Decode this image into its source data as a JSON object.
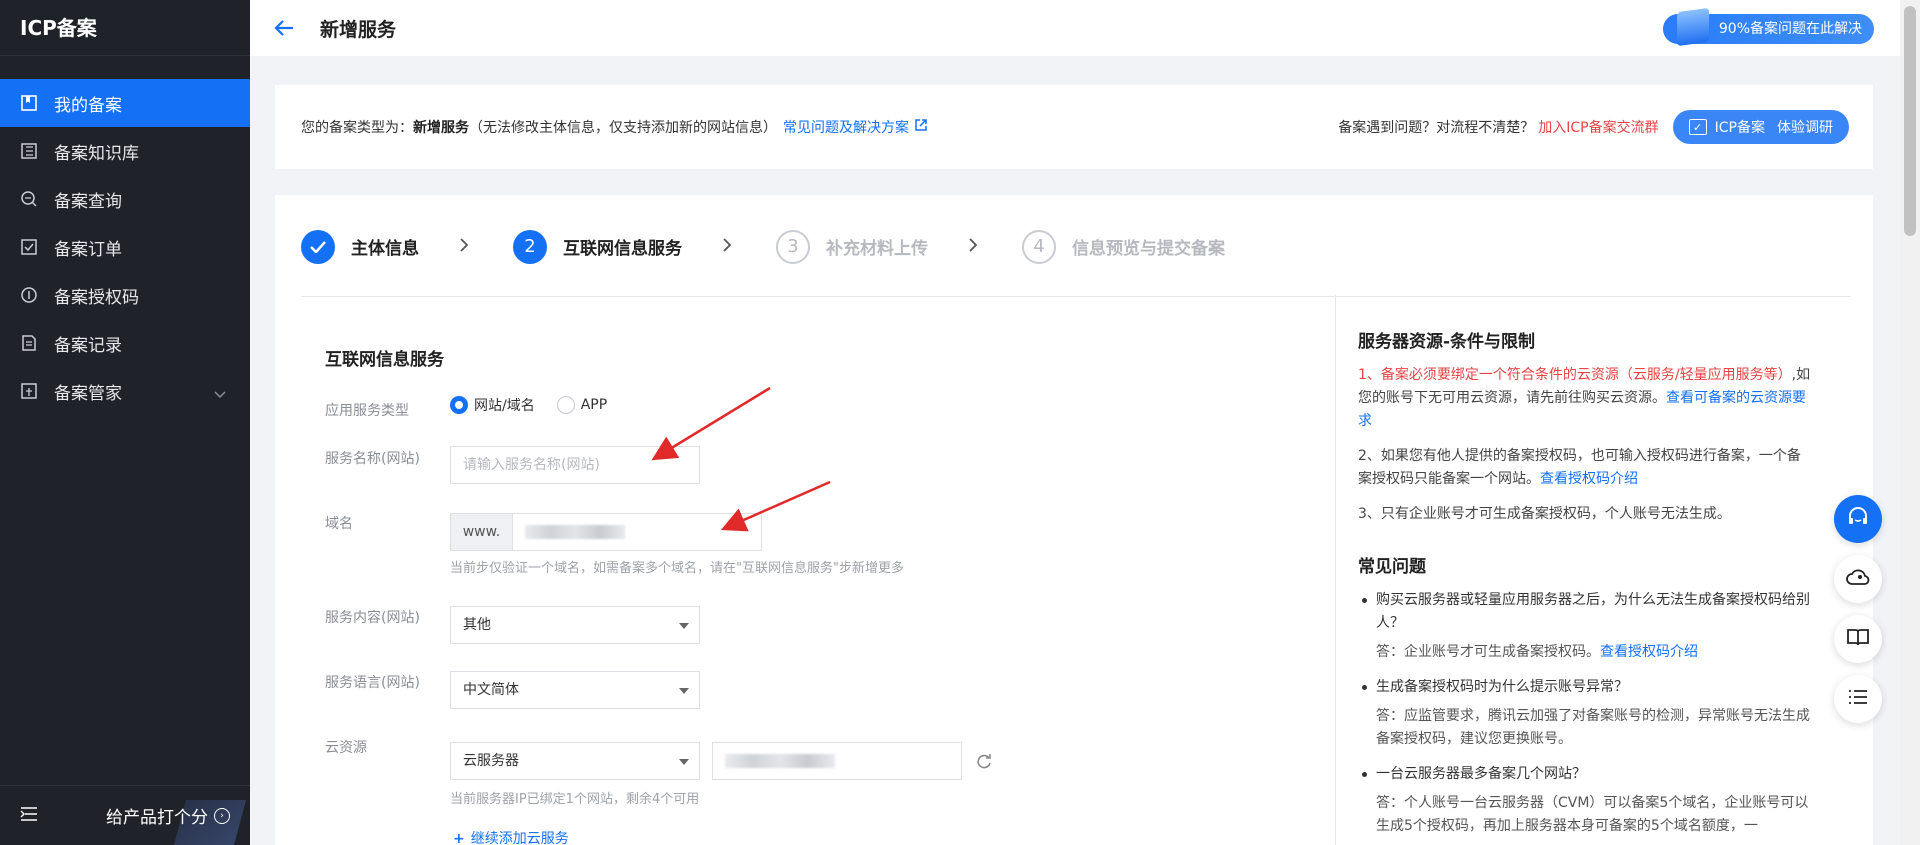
{
  "brand": "ICP备案",
  "sidebar": {
    "items": [
      {
        "label": "我的备案",
        "icon": "bookmark-icon"
      },
      {
        "label": "备案知识库",
        "icon": "book-icon"
      },
      {
        "label": "备案查询",
        "icon": "search-icon"
      },
      {
        "label": "备案订单",
        "icon": "checklist-icon"
      },
      {
        "label": "备案授权码",
        "icon": "code-icon"
      },
      {
        "label": "备案记录",
        "icon": "document-icon"
      },
      {
        "label": "备案管家",
        "icon": "manager-icon"
      }
    ],
    "footer_label": "给产品打个分"
  },
  "header": {
    "title": "新增服务",
    "help_pill": "90%备案问题在此解决"
  },
  "infobar": {
    "prefix": "您的备案类型为：",
    "type": "新增服务",
    "note": "（无法修改主体信息，仅支持添加新的网站信息）",
    "faq_link": "常见问题及解决方案",
    "question": "备案遇到问题？对流程不清楚？",
    "join_link": "加入ICP备案交流群",
    "survey_left": "ICP备案",
    "survey_right": "体验调研"
  },
  "steps": [
    {
      "num": "✓",
      "label": "主体信息",
      "state": "done"
    },
    {
      "num": "2",
      "label": "互联网信息服务",
      "state": "current"
    },
    {
      "num": "3",
      "label": "补充材料上传",
      "state": "todo"
    },
    {
      "num": "4",
      "label": "信息预览与提交备案",
      "state": "todo"
    }
  ],
  "form": {
    "title": "互联网信息服务",
    "service_type_label": "应用服务类型",
    "service_type_options": [
      "网站/域名",
      "APP"
    ],
    "service_type_selected": "网站/域名",
    "service_name_label": "服务名称(网站)",
    "service_name_placeholder": "请输入服务名称(网站)",
    "domain_label": "域名",
    "domain_prefix": "www.",
    "domain_hint": "当前步仅验证一个域名，如需备案多个域名，请在\"互联网信息服务\"步新增更多",
    "content_label": "服务内容(网站)",
    "content_value": "其他",
    "language_label": "服务语言(网站)",
    "language_value": "中文简体",
    "cloud_label": "云资源",
    "cloud_type_value": "云服务器",
    "cloud_hint": "当前服务器IP已绑定1个网站，剩余4个可用",
    "add_cloud": "继续添加云服务"
  },
  "panel": {
    "title": "服务器资源-条件与限制",
    "p1_red": "1、备案必须要绑定一个符合条件的云资源（云服务/轻量应用服务等）",
    "p1_text": ",如您的账号下无可用云资源，请先前往购买云资源。",
    "p1_link": "查看可备案的云资源要求",
    "p2_text": "2、如果您有他人提供的备案授权码，也可输入授权码进行备案，一个备案授权码只能备案一个网站。",
    "p2_link": "查看授权码介绍",
    "p3_text": "3、只有企业账号才可生成备案授权码，个人账号无法生成。",
    "faq_title": "常见问题",
    "faq": [
      {
        "q": "购买云服务器或轻量应用服务器之后，为什么无法生成备案授权码给别人？",
        "a": "答：企业账号才可生成备案授权码。",
        "link": "查看授权码介绍"
      },
      {
        "q": "生成备案授权码时为什么提示账号异常？",
        "a": "答：应监管要求，腾讯云加强了对备案账号的检测，异常账号无法生成备案授权码，建议您更换账号。",
        "link": ""
      },
      {
        "q": "一台云服务器最多备案几个网站？",
        "a": "答：个人账号一台云服务器（CVM）可以备案5个域名，企业账号可以生成5个授权码，再加上服务器本身可备案的5个域名额度，一",
        "link": ""
      }
    ]
  },
  "colors": {
    "accent": "#1470f5",
    "sidebar": "#1f2329",
    "warning": "#e54545",
    "annotation": "#e02a2a"
  }
}
